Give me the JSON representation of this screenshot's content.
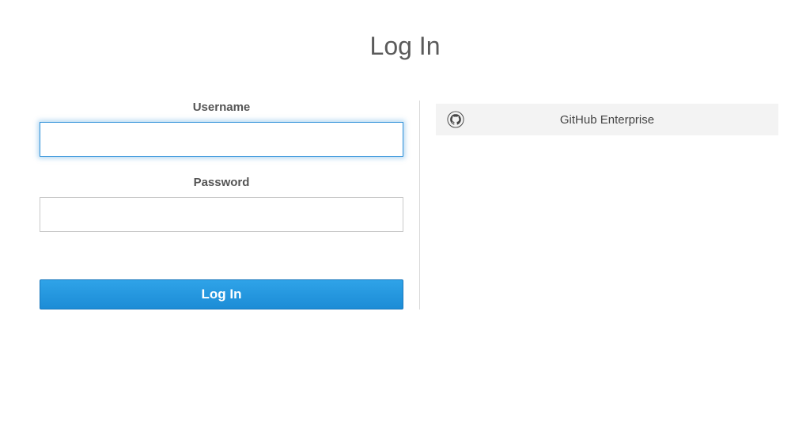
{
  "title": "Log In",
  "form": {
    "username_label": "Username",
    "username_value": "",
    "password_label": "Password",
    "password_value": "",
    "submit_label": "Log In"
  },
  "sso": {
    "provider_icon": "github-icon",
    "provider_label": "GitHub Enterprise"
  }
}
